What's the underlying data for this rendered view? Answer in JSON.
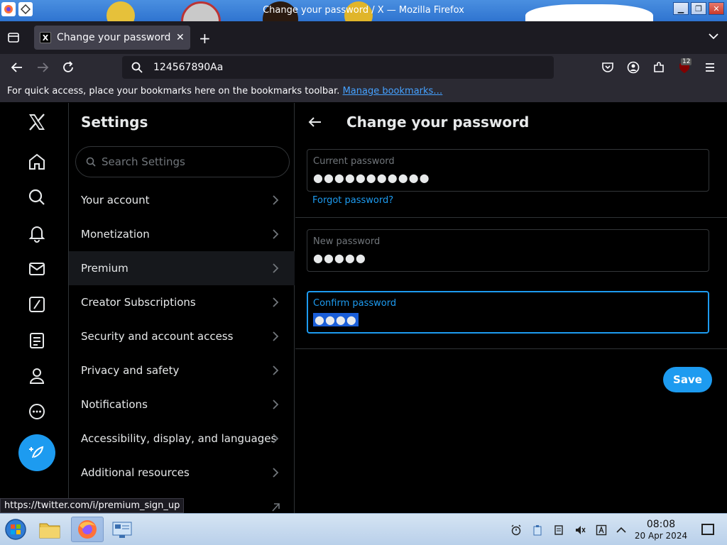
{
  "window": {
    "title": "Change your password / X — Mozilla Firefox",
    "controls": [
      "minimize",
      "maximize",
      "close"
    ]
  },
  "browser": {
    "tab_label": "Change your password / X",
    "tab_favicon": "X",
    "url_text": "124567890Aa",
    "extension_badge": "12",
    "bookmarks_text": "For quick access, place your bookmarks here on the bookmarks toolbar.",
    "bookmarks_link": "Manage bookmarks…",
    "status_url": "https://twitter.com/i/premium_sign_up"
  },
  "sidebar": {
    "items": [
      {
        "name": "x-logo-icon"
      },
      {
        "name": "home-icon"
      },
      {
        "name": "explore-search-icon"
      },
      {
        "name": "notifications-bell-icon"
      },
      {
        "name": "messages-envelope-icon"
      },
      {
        "name": "grok-slash-icon"
      },
      {
        "name": "lists-icon"
      },
      {
        "name": "profile-icon"
      },
      {
        "name": "more-icon"
      }
    ],
    "compose_icon": "compose-feather-icon"
  },
  "settings": {
    "title": "Settings",
    "search_placeholder": "Search Settings",
    "menu": [
      {
        "label": "Your account"
      },
      {
        "label": "Monetization"
      },
      {
        "label": "Premium",
        "active": true
      },
      {
        "label": "Creator Subscriptions"
      },
      {
        "label": "Security and account access"
      },
      {
        "label": "Privacy and safety"
      },
      {
        "label": "Notifications"
      },
      {
        "label": "Accessibility, display, and languages"
      },
      {
        "label": "Additional resources"
      },
      {
        "label": "",
        "external": true
      }
    ]
  },
  "main": {
    "title": "Change your password",
    "current_password": {
      "label": "Current password",
      "value": "●●●●●●●●●●●"
    },
    "forgot_link": "Forgot password?",
    "new_password": {
      "label": "New password",
      "value": "●●●●●"
    },
    "confirm_password": {
      "label": "Confirm password",
      "value": "●●●●"
    },
    "save_label": "Save"
  },
  "taskbar": {
    "time": "08:08",
    "date": "20 Apr 2024"
  },
  "colors": {
    "accent": "#1d9bf0",
    "background": "#000000",
    "text": "#e7e9ea",
    "muted": "#71767b",
    "border": "#2f3336"
  }
}
